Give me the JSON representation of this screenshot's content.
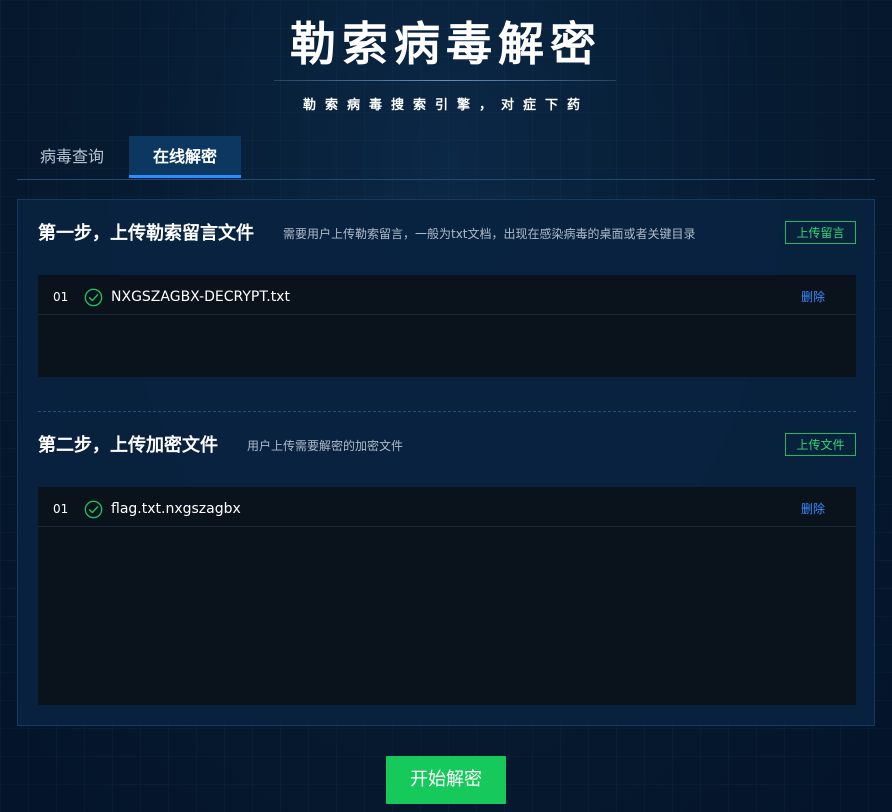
{
  "header": {
    "title": "勒索病毒解密",
    "subtitle": "勒索病毒搜索引擎，对症下药"
  },
  "tabs": [
    {
      "label": "病毒查询",
      "active": false
    },
    {
      "label": "在线解密",
      "active": true
    }
  ],
  "steps": [
    {
      "title": "第一步，上传勒索留言文件",
      "description": "需要用户上传勒索留言，一般为txt文档，出现在感染病毒的桌面或者关键目录",
      "upload_label": "上传留言",
      "files": [
        {
          "index": "01",
          "name": "NXGSZAGBX-DECRYPT.txt",
          "status_icon": "check-circle-icon",
          "delete_label": "删除"
        }
      ]
    },
    {
      "title": "第二步，上传加密文件",
      "description": "用户上传需要解密的加密文件",
      "upload_label": "上传文件",
      "files": [
        {
          "index": "01",
          "name": "flag.txt.nxgszagbx",
          "status_icon": "check-circle-icon",
          "delete_label": "删除"
        }
      ]
    }
  ],
  "actions": {
    "start_label": "开始解密"
  },
  "colors": {
    "accent_blue": "#2a8cff",
    "success_green": "#16c95b",
    "link_blue": "#3a8bff",
    "background": "#071a2e"
  }
}
